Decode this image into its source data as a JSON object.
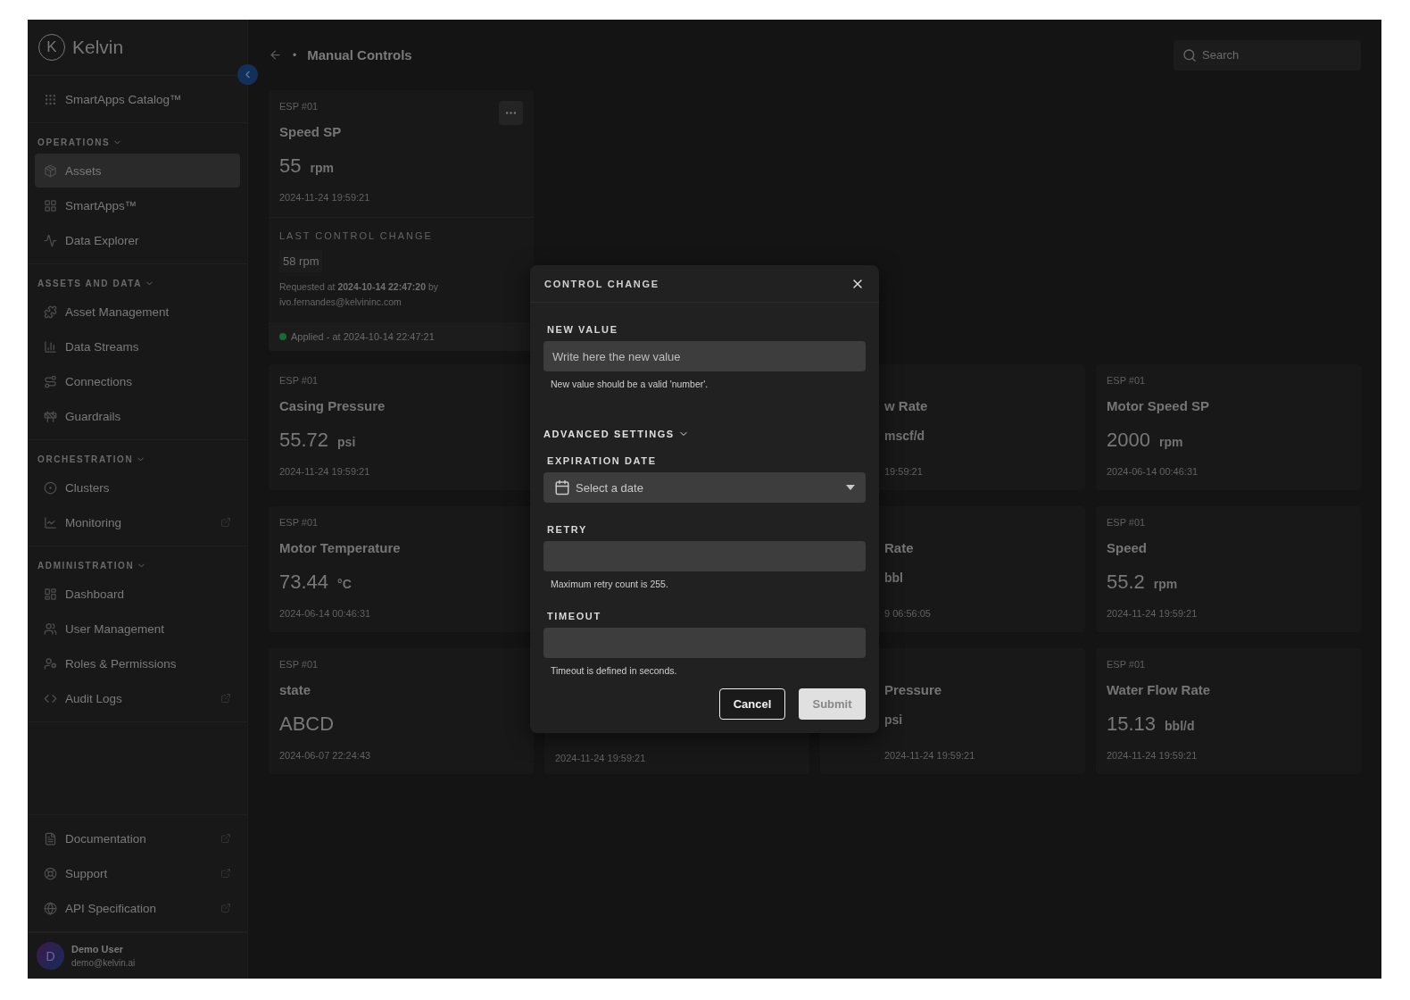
{
  "sidebar": {
    "logo_letter": "K",
    "logo": "Kelvin",
    "catalog": "SmartApps Catalog™",
    "sections": [
      {
        "title": "OPERATIONS",
        "expanded": true,
        "items": [
          {
            "label": "Assets",
            "selected": true,
            "external": false
          },
          {
            "label": "SmartApps™",
            "selected": false,
            "external": false
          },
          {
            "label": "Data Explorer",
            "selected": false,
            "external": false
          }
        ]
      },
      {
        "title": "ASSETS AND DATA",
        "expanded": true,
        "items": [
          {
            "label": "Asset Management",
            "selected": false,
            "external": false
          },
          {
            "label": "Data Streams",
            "selected": false,
            "external": false
          },
          {
            "label": "Connections",
            "selected": false,
            "external": false
          },
          {
            "label": "Guardrails",
            "selected": false,
            "external": false
          }
        ]
      },
      {
        "title": "ORCHESTRATION",
        "expanded": true,
        "items": [
          {
            "label": "Clusters",
            "selected": false,
            "external": false
          },
          {
            "label": "Monitoring",
            "selected": false,
            "external": true
          }
        ]
      },
      {
        "title": "ADMINISTRATION",
        "expanded": true,
        "items": [
          {
            "label": "Dashboard",
            "selected": false,
            "external": false
          },
          {
            "label": "User Management",
            "selected": false,
            "external": false
          },
          {
            "label": "Roles & Permissions",
            "selected": false,
            "external": false
          },
          {
            "label": "Audit Logs",
            "selected": false,
            "external": true
          }
        ]
      }
    ],
    "footer": [
      {
        "label": "Documentation",
        "external": true
      },
      {
        "label": "Support",
        "external": true
      },
      {
        "label": "API Specification",
        "external": true
      }
    ],
    "user": {
      "initial": "D",
      "name": "Demo User",
      "email": "demo@kelvin.ai"
    }
  },
  "header": {
    "title": "Manual Controls",
    "separator": "•",
    "search": {
      "placeholder": "Search"
    }
  },
  "control_card": {
    "asset": "ESP #01",
    "title": "Speed SP",
    "value": "55",
    "unit": "rpm",
    "time": "2024-11-24 19:59:21",
    "last_change": {
      "heading": "LAST CONTROL CHANGE",
      "value": "58 rpm",
      "requested": "Requested at **2024-10-14 22:47:20** by",
      "user": "ivo.fernandes@kelvininc.com",
      "color": "#1b6a34",
      "status_text": "Applied - at 2024-10-14 22:47:21"
    }
  },
  "card_columns": [
    [
      {
        "kind": "full",
        "asset": "ESP #01",
        "title": "Casing Pressure",
        "value": "55.72",
        "unit": "psi",
        "time": "2024-11-24 19:59:21"
      },
      {
        "kind": "full",
        "asset": "ESP #01",
        "title": "Motor Temperature",
        "value": "73.44",
        "unit": "°C",
        "time": "2024-06-14 00:46:31"
      },
      {
        "kind": "full",
        "asset": "ESP #01",
        "title": "state",
        "value": "ABCD",
        "time": "2024-06-07 22:24:43"
      }
    ],
    [
      {
        "kind": "bottom",
        "time": "2024-11-24 19:59:21"
      }
    ],
    [
      {
        "kind": "offset",
        "title": "w Rate",
        "unit": "mscf/d",
        "time": "19:59:21"
      },
      {
        "kind": "offset",
        "title": "Rate",
        "unit": "bbl",
        "time": "9 06:56:05"
      },
      {
        "kind": "offset",
        "title": "Pressure",
        "unit": "psi",
        "time": "2024-11-24 19:59:21"
      }
    ],
    [
      {
        "kind": "full",
        "asset": "ESP #01",
        "title": "Motor Speed SP",
        "value": "2000",
        "unit": "rpm",
        "time": "2024-06-14 00:46:31"
      },
      {
        "kind": "full",
        "asset": "ESP #01",
        "title": "Speed",
        "value": "55.2",
        "unit": "rpm",
        "time": "2024-11-24 19:59:21"
      },
      {
        "kind": "full",
        "asset": "ESP #01",
        "title": "Water Flow Rate",
        "value": "15.13",
        "unit": "bbl/d",
        "time": "2024-11-24 19:59:21"
      }
    ]
  ],
  "dialog": {
    "title": "CONTROL CHANGE",
    "fields": [
      {
        "kind": "text",
        "label": "NEW VALUE",
        "placeholder": "Write here the new value",
        "help": "New value should be a valid 'number'."
      },
      {
        "kind": "section",
        "label": "ADVANCED SETTINGS",
        "expanded": true
      },
      {
        "kind": "date",
        "label": "EXPIRATION DATE",
        "placeholder": "Select a date"
      },
      {
        "kind": "text",
        "label": "RETRY",
        "help": "Maximum retry count is 255."
      },
      {
        "kind": "text",
        "label": "TIMEOUT",
        "help": "Timeout is defined in seconds."
      }
    ],
    "buttons": [
      {
        "label": "Cancel",
        "kind": "secondary",
        "disabled": false
      },
      {
        "label": "Submit",
        "kind": "primary",
        "disabled": true
      }
    ]
  }
}
